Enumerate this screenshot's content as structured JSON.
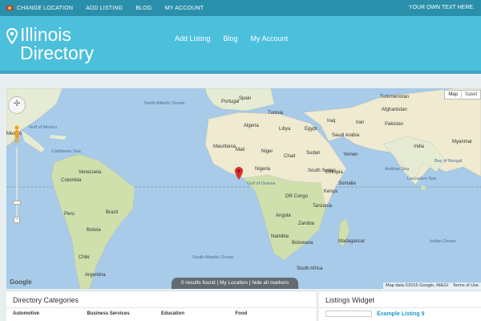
{
  "topbar": {
    "items": [
      {
        "label": "CHANGE LOCATION",
        "icon": "flag-icon"
      },
      {
        "label": "ADD LISTING"
      },
      {
        "label": "BLOG"
      },
      {
        "label": "MY ACCOUNT"
      }
    ],
    "right_text": "YOUR OWN TEXT HERE."
  },
  "header": {
    "title_line1": "Illinois",
    "title_line2": "Directory",
    "nav": [
      "Add Listing",
      "Blog",
      "My Account"
    ]
  },
  "map": {
    "type_buttons": [
      "Map",
      "Satell"
    ],
    "counter": [
      "0 results found",
      "My Location",
      "hide all markers"
    ],
    "credit": [
      "Map data ©2015 Google, INEGI",
      "Terms of Use"
    ],
    "brand": "Google",
    "colors": {
      "water": "#a7cbe8",
      "land": "#e8efd6",
      "green": "#c7dca4",
      "desert": "#f0ead0"
    },
    "labels": [
      "North Atlantic Ocean",
      "Portugal",
      "Spain",
      "Tunisia",
      "Algeria",
      "Libya",
      "Egypt",
      "Mauritania",
      "Mali",
      "Niger",
      "Chad",
      "Sudan",
      "Nigeria",
      "Ethiopia",
      "Kenya",
      "DR Congo",
      "Tanzania",
      "Angola",
      "Zambia",
      "Namibia",
      "Botswana",
      "Madagascar",
      "South Africa",
      "Saudi Arabia",
      "Yemen",
      "Iraq",
      "Iran",
      "Turkmenistan",
      "Afghanistan",
      "Pakistan",
      "India",
      "Myanmar",
      "Arabian Sea",
      "Bay of Bengal",
      "Laccadive Sea",
      "Indian Ocean",
      "South Atlantic Ocean",
      "Brazil",
      "Venezuela",
      "Colombia",
      "Peru",
      "Bolivia",
      "Chile",
      "Argentina",
      "Mexico",
      "Gulf of Mexico",
      "Caribbean Sea",
      "Gulf of Guinea",
      "Somalia",
      "South Sudan"
    ]
  },
  "categories": {
    "title": "Directory Categories",
    "columns": [
      "Automotive",
      "Business Services",
      "Education",
      "Food"
    ]
  },
  "listings_widget": {
    "title": "Listings Widget",
    "items": [
      "Example Listing 9"
    ]
  }
}
